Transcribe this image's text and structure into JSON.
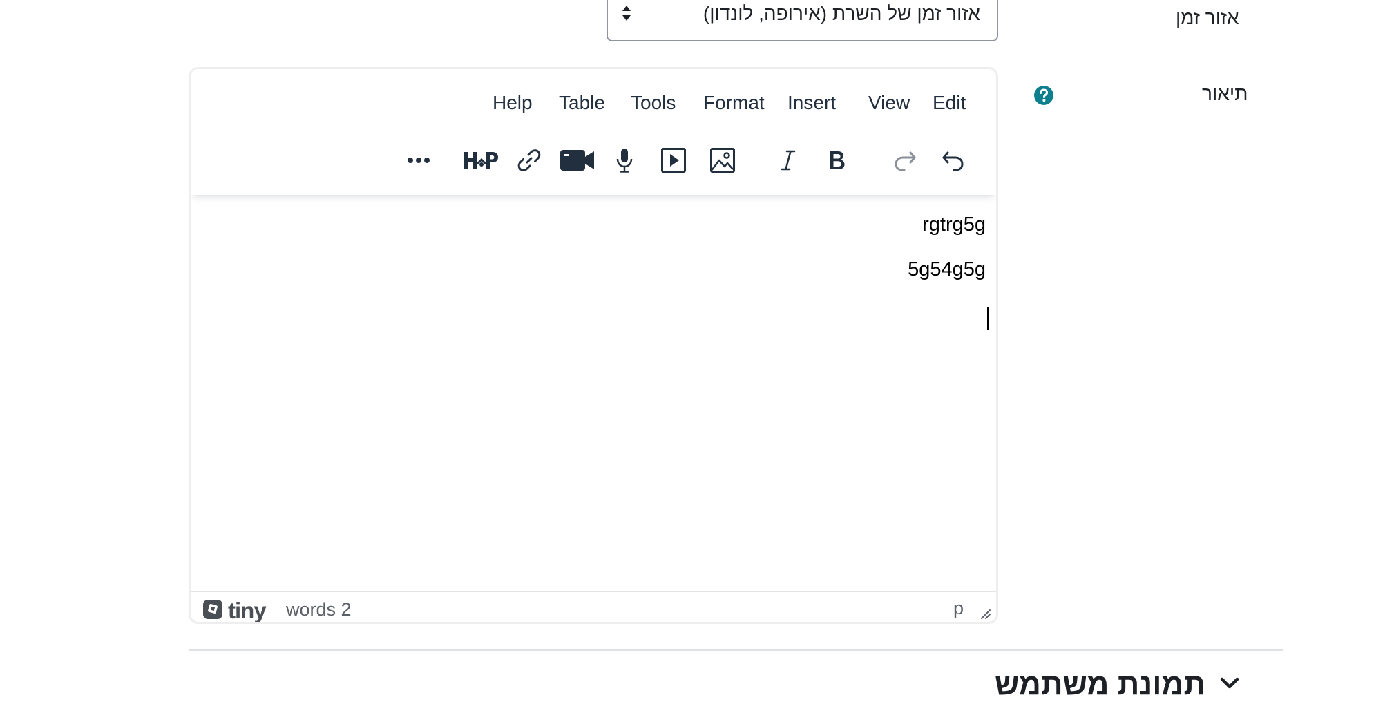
{
  "form": {
    "timezone": {
      "label": "אזור זמן",
      "selected": "אזור זמן של השרת (אירופה, לונדון)"
    },
    "description": {
      "label": "תיאור"
    }
  },
  "editor": {
    "menubar": [
      "Edit",
      "View",
      "Insert",
      "Format",
      "Tools",
      "Table",
      "Help"
    ],
    "toolbar": [
      {
        "name": "undo-icon"
      },
      {
        "name": "redo-icon"
      },
      {
        "name": "bold-icon"
      },
      {
        "name": "italic-icon"
      },
      {
        "name": "image-icon"
      },
      {
        "name": "media-icon"
      },
      {
        "name": "microphone-icon"
      },
      {
        "name": "video-camera-icon"
      },
      {
        "name": "link-icon"
      },
      {
        "name": "h5p-icon",
        "label": "H5P"
      },
      {
        "name": "more-icon"
      }
    ],
    "content": [
      "rgtrg5g",
      "5g54g5g"
    ],
    "status": {
      "brand": "tiny",
      "wordcount": "words 2",
      "path": "p"
    },
    "colors": {
      "border": "#eeeeee",
      "toolbar_icon": "#222f3e",
      "disabled_icon": "#8a9098"
    }
  },
  "section": {
    "title": "תמונת משתמש"
  },
  "colors": {
    "help_icon": "#0f6cbf",
    "help_icon_bg": "#0e7f8c",
    "text": "#1d2125",
    "divider": "#dee2e6"
  }
}
